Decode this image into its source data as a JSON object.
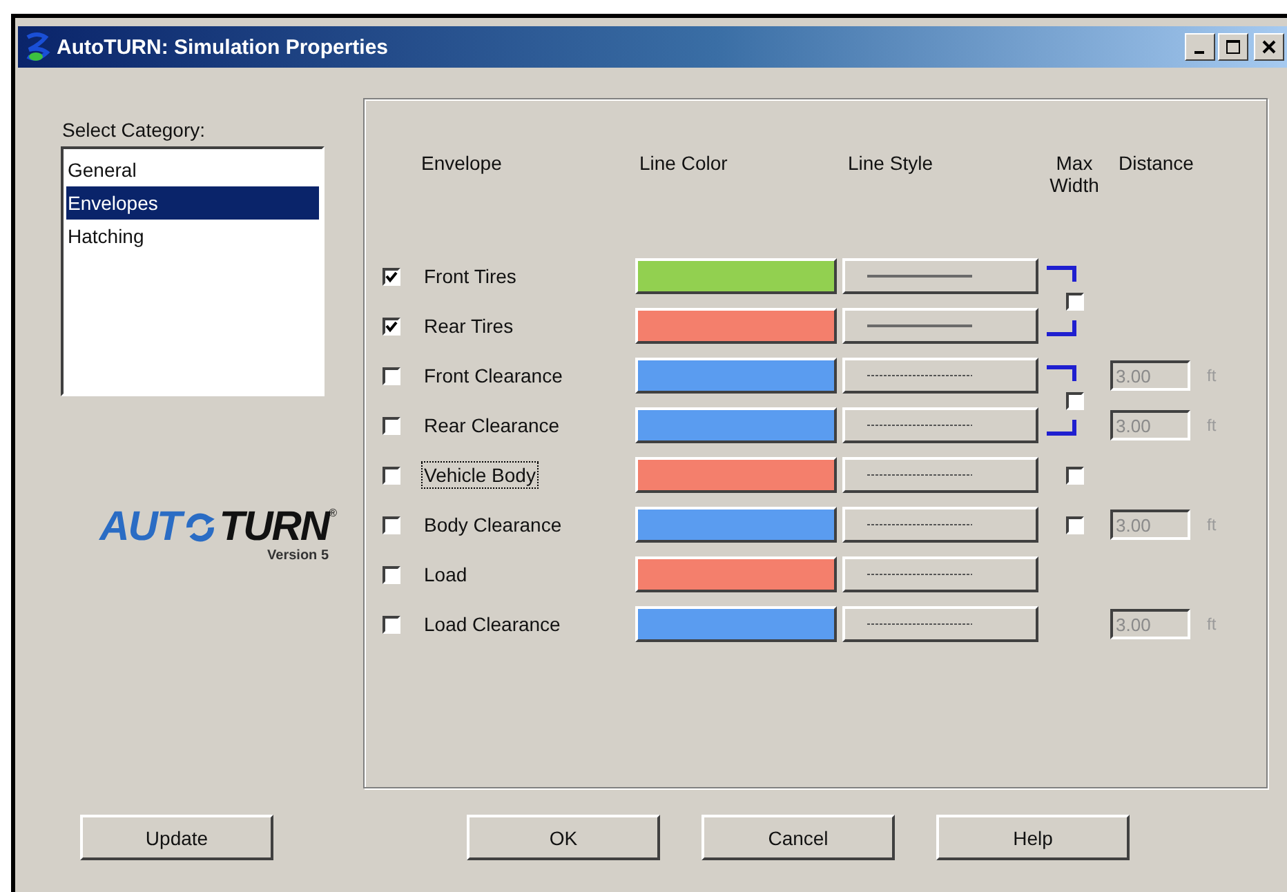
{
  "window": {
    "title": "AutoTURN: Simulation Properties"
  },
  "category": {
    "label": "Select Category:",
    "items": [
      {
        "label": "General",
        "selected": false
      },
      {
        "label": "Envelopes",
        "selected": true
      },
      {
        "label": "Hatching",
        "selected": false
      }
    ]
  },
  "logo": {
    "left": "AUT",
    "right": "TURN",
    "mark": "®",
    "version": "Version 5"
  },
  "columns": [
    "Envelope",
    "Line Color",
    "Line Style",
    "Max Width",
    "Distance"
  ],
  "rows": [
    {
      "label": "Front Tires",
      "checked": true,
      "focused": false,
      "color": "#92d050",
      "line_style": {
        "kind": "solid"
      },
      "max_width": {
        "kind": "bracket",
        "checked": false
      }
    },
    {
      "label": "Rear Tires",
      "checked": true,
      "focused": false,
      "color": "#f47f6c",
      "line_style": {
        "kind": "solid"
      }
    },
    {
      "label": "Front Clearance",
      "checked": false,
      "focused": false,
      "color": "#5a9cf0",
      "line_style": {
        "kind": "dashed"
      },
      "max_width": {
        "kind": "bracket",
        "checked": false
      },
      "distance": {
        "value": "3.00",
        "unit": "ft",
        "disabled": true
      }
    },
    {
      "label": "Rear Clearance",
      "checked": false,
      "focused": false,
      "color": "#5a9cf0",
      "line_style": {
        "kind": "dashed"
      },
      "distance": {
        "value": "3.00",
        "unit": "ft",
        "disabled": true
      }
    },
    {
      "label": "Vehicle Body",
      "checked": false,
      "focused": true,
      "color": "#f47f6c",
      "line_style": {
        "kind": "dashed"
      },
      "max_width": {
        "kind": "box",
        "checked": false
      }
    },
    {
      "label": "Body Clearance",
      "checked": false,
      "focused": false,
      "color": "#5a9cf0",
      "line_style": {
        "kind": "dashed"
      },
      "max_width": {
        "kind": "box",
        "checked": false
      },
      "distance": {
        "value": "3.00",
        "unit": "ft",
        "disabled": true
      }
    },
    {
      "label": "Load",
      "checked": false,
      "focused": false,
      "color": "#f47f6c",
      "line_style": {
        "kind": "dashed"
      }
    },
    {
      "label": "Load Clearance",
      "checked": false,
      "focused": false,
      "color": "#5a9cf0",
      "line_style": {
        "kind": "dashed"
      },
      "distance": {
        "value": "3.00",
        "unit": "ft",
        "disabled": true
      }
    }
  ],
  "buttons": {
    "update": "Update",
    "actions": [
      "OK",
      "Cancel",
      "Help"
    ]
  }
}
